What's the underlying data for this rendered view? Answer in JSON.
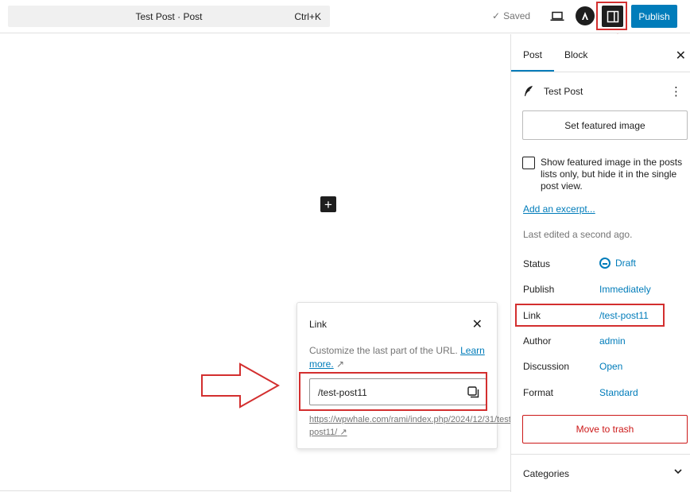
{
  "header": {
    "document_title": "Test Post · Post",
    "shortcut": "Ctrl+K",
    "saved_label": "Saved",
    "publish_label": "Publish",
    "icons": [
      "view-icon",
      "astra-icon",
      "settings-sidebar-icon"
    ]
  },
  "canvas": {
    "inserter_icon": "+"
  },
  "link_popover": {
    "title": "Link",
    "description": "Customize the last part of the URL.",
    "learn_more": "Learn more.",
    "external_glyph": "↗",
    "slug_value": "/test-post11",
    "full_url": "https://wpwhale.com/rami/index.php/2024/12/31/test-post11/"
  },
  "sidebar": {
    "tabs": [
      {
        "label": "Post",
        "active": true
      },
      {
        "label": "Block",
        "active": false
      }
    ],
    "post_title": "Test Post",
    "featured_image_button": "Set featured image",
    "checkbox_label": "Show featured image in the posts lists only, but hide it in the single post view.",
    "excerpt_link": "Add an excerpt...",
    "last_edited": "Last edited a second ago.",
    "rows": [
      {
        "label": "Status",
        "value": "Draft"
      },
      {
        "label": "Publish",
        "value": "Immediately"
      },
      {
        "label": "Link",
        "value": "/test-post11"
      },
      {
        "label": "Author",
        "value": "admin"
      },
      {
        "label": "Discussion",
        "value": "Open"
      },
      {
        "label": "Format",
        "value": "Standard"
      }
    ],
    "trash_button": "Move to trash",
    "categories_label": "Categories"
  },
  "colors": {
    "accent": "#007cba",
    "danger": "#cc1818",
    "annotation": "#d32f2f"
  }
}
